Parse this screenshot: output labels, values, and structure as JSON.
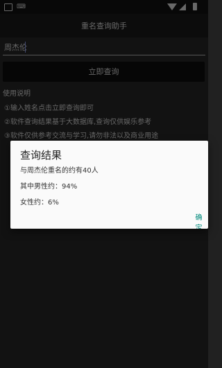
{
  "app": {
    "title": "重名查询助手"
  },
  "form": {
    "name_value": "周杰伦",
    "query_button_label": "立即查询"
  },
  "instructions": {
    "title": "使用说明",
    "items": [
      "①输入姓名点击立即查询即可",
      "②软件查询结果基于大数据库,查询仅供娱乐参考",
      "③软件仅供参考交流与学习,请勿非法以及商业用途"
    ]
  },
  "dialog": {
    "title": "查询结果",
    "summary": "与周杰伦重名的约有40人",
    "male_text": "其中男性约：94%",
    "female_text": "女性约：6%",
    "ok_label": "确定"
  }
}
